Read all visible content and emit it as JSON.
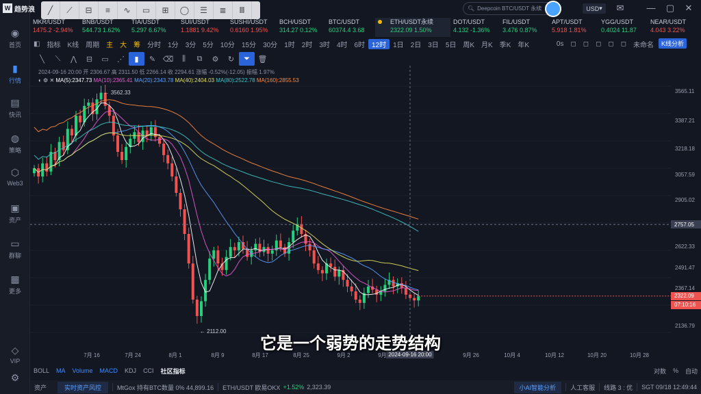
{
  "app": {
    "logo_text": "趋势浪"
  },
  "top": {
    "search_placeholder": "Deepcoin BTC/USDT 永续",
    "currency": "USD"
  },
  "sidebar": {
    "items": [
      {
        "label": "首页",
        "icon": "home-icon"
      },
      {
        "label": "行情",
        "icon": "chart-bar-icon"
      },
      {
        "label": "快讯",
        "icon": "news-icon"
      },
      {
        "label": "策略",
        "icon": "robot-icon"
      },
      {
        "label": "Web3",
        "icon": "web3-icon"
      },
      {
        "label": "资产",
        "icon": "wallet-icon"
      },
      {
        "label": "群聊",
        "icon": "chat-icon"
      },
      {
        "label": "更多",
        "icon": "grid-icon"
      },
      {
        "label": "VIP",
        "icon": "diamond-icon"
      }
    ]
  },
  "tickers": [
    {
      "sym": "MKR/USDT",
      "price": "1475.2",
      "chg": "-2.94%",
      "dir": "down"
    },
    {
      "sym": "BNB/USDT",
      "price": "544.73",
      "chg": "1.62%",
      "dir": "up"
    },
    {
      "sym": "TIA/USDT",
      "price": "5.297",
      "chg": "6.67%",
      "dir": "up"
    },
    {
      "sym": "SUI/USDT",
      "price": "1.1881",
      "chg": "9.42%",
      "dir": "down"
    },
    {
      "sym": "SUSHI/USDT",
      "price": "0.6160",
      "chg": "1.95%",
      "dir": "down"
    },
    {
      "sym": "BCH/USDT",
      "price": "314.27",
      "chg": "0.12%",
      "dir": "up"
    },
    {
      "sym": "BTC/USDT",
      "price": "60374.4",
      "chg": "3.68",
      "dir": "up"
    },
    {
      "sym": "ETH/USDT永续",
      "price": "2322.09",
      "chg": "1.50%",
      "dir": "up",
      "active": true
    },
    {
      "sym": "DOT/USDT",
      "price": "4.132",
      "chg": "-1.36%",
      "dir": "up"
    },
    {
      "sym": "FIL/USDT",
      "price": "3.476",
      "chg": "0.87%",
      "dir": "up"
    },
    {
      "sym": "APT/USDT",
      "price": "5.918",
      "chg": "1.81%",
      "dir": "down"
    },
    {
      "sym": "YGG/USDT",
      "price": "0.4024",
      "chg": "11.87",
      "dir": "up"
    },
    {
      "sym": "NEAR/USDT",
      "price": "4.043",
      "chg": "3.22%",
      "dir": "down"
    }
  ],
  "intervals": [
    "指标",
    "K线",
    "周期",
    "分时",
    "1分",
    "3分",
    "5分",
    "10分",
    "15分",
    "30分",
    "1时",
    "2时",
    "3时",
    "4时",
    "6时",
    "12时",
    "1日",
    "2日",
    "3日",
    "5日",
    "周K",
    "月K",
    "季K",
    "年K"
  ],
  "interval_selected": "12时",
  "indicator_types": [
    "主",
    "大",
    "筹"
  ],
  "right_controls": {
    "ticker_seconds": "0s",
    "layout": "未命名",
    "kline_analysis": "K线分析"
  },
  "info_line": "2024-09-16 20:00  开 2306.67  高 2311.50  低 2266.14  收 2294.61  涨幅 -0.52%(-12.05)  振幅 1.97%",
  "ma_line": [
    {
      "text": "MA(5):2347.73",
      "color": "#ffffff"
    },
    {
      "text": "MA(10):2365.41",
      "color": "#e85bd1"
    },
    {
      "text": "MA(20):2343.78",
      "color": "#5aa0ff"
    },
    {
      "text": "MA(40):2404.03",
      "color": "#e0e05a"
    },
    {
      "text": "MA(80):2522.78",
      "color": "#3ec6c6"
    },
    {
      "text": "MA(160):2855.53",
      "color": "#ff8a3d"
    }
  ],
  "price_axis": [
    "3565.11",
    "3387.21",
    "3218.18",
    "3057.59",
    "2905.02",
    "2622.33",
    "2491.47",
    "2367.14",
    "2136.79"
  ],
  "crosshair_price": "2757.05",
  "last_price": "2322.09",
  "countdown": "07:10:16",
  "high_label": "3562.33",
  "low_label": "2112.00",
  "date_axis": [
    "7月 16",
    "7月 24",
    "8月 1",
    "8月 9",
    "8月 17",
    "8月 25",
    "9月 2",
    "9月 10",
    "9月 26",
    "10月 4",
    "10月 12",
    "10月 20",
    "10月 28"
  ],
  "crosshair_date": "2024-09-16 20:00",
  "subtitle": "它是一个弱势的走势结构",
  "indicator_tabs": [
    "BOLL",
    "MA",
    "Volume",
    "MACD",
    "KDJ",
    "CCI",
    "社区指标"
  ],
  "indicator_right": [
    "对数",
    "%",
    "自动"
  ],
  "status": {
    "asset": "资产",
    "risk": "实时资产风控",
    "mtgox": "MtGox 持有BTC数量  0%  44,899.16",
    "eth": "ETH/USDT 欧易OKX",
    "eth_chg": "+1.52%",
    "eth_price": "2,323.39",
    "ai": "小AI智能分析",
    "service": "人工客服",
    "line": "线路 3 : 优",
    "time": "SGT  09/18 12:49:44"
  },
  "chart_data": {
    "type": "candlestick",
    "title": "ETH/USDT永续 12时",
    "x_range": [
      "2024-07-10",
      "2024-10-30"
    ],
    "ylim": [
      2100,
      3600
    ],
    "notable": {
      "high": 3562.33,
      "low": 2112.0,
      "last": 2322.09,
      "crosshair": 2757.05
    },
    "closes": [
      3100,
      3050,
      3130,
      3080,
      3200,
      3150,
      3260,
      3210,
      3340,
      3300,
      3420,
      3380,
      3480,
      3500,
      3430,
      3520,
      3560,
      3480,
      3420,
      3300,
      3200,
      3150,
      3230,
      3280,
      3320,
      3260,
      3330,
      3300,
      3350,
      3290,
      3250,
      3180,
      3130,
      3050,
      2950,
      2850,
      2700,
      2520,
      2300,
      2200,
      2290,
      2420,
      2550,
      2600,
      2520,
      2480,
      2560,
      2620,
      2600,
      2650,
      2610,
      2560,
      2600,
      2640,
      2590,
      2620,
      2580,
      2600,
      2660,
      2620,
      2580,
      2650,
      2720,
      2760,
      2700,
      2640,
      2600,
      2520,
      2480,
      2460,
      2520,
      2500,
      2440,
      2480,
      2420,
      2380,
      2350,
      2300,
      2280,
      2340,
      2380,
      2360,
      2330,
      2350,
      2390,
      2420,
      2380,
      2400,
      2370,
      2330,
      2310,
      2295,
      2322
    ]
  }
}
